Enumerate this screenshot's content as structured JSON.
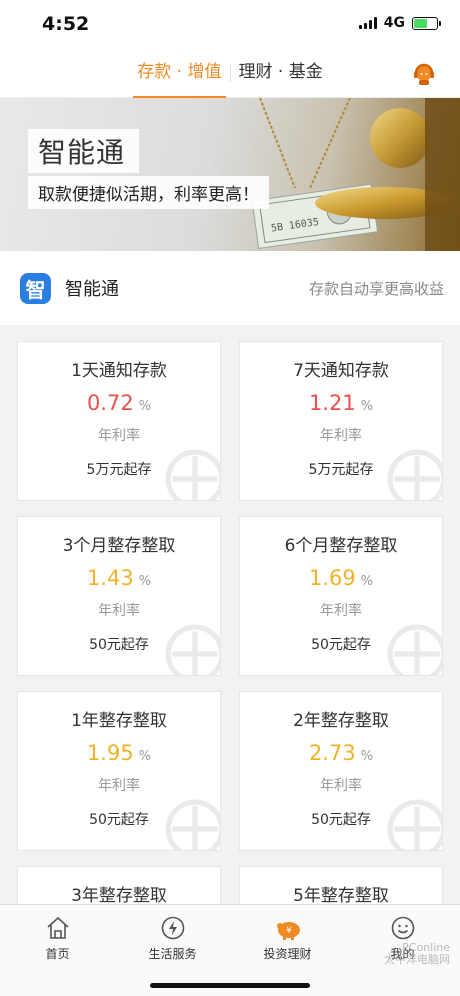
{
  "status": {
    "time": "4:52",
    "network": "4G",
    "battery_level": 0.6
  },
  "header": {
    "tabs": [
      {
        "label": "存款 · 增值",
        "active": true
      },
      {
        "label": "理财 · 基金",
        "active": false
      }
    ],
    "service_icon": "customer-service-icon"
  },
  "banner": {
    "title": "智能通",
    "subtitle": "取款便捷似活期，利率更高！"
  },
  "product": {
    "logo_char": "智",
    "name": "智能通",
    "description": "存款自动享更高收益"
  },
  "cards": [
    {
      "title": "1天通知存款",
      "rate": "0.72",
      "unit": "%",
      "rate_label": "年利率",
      "minimum": "5万元起存",
      "rate_color": "#e8524a"
    },
    {
      "title": "7天通知存款",
      "rate": "1.21",
      "unit": "%",
      "rate_label": "年利率",
      "minimum": "5万元起存",
      "rate_color": "#e8524a"
    },
    {
      "title": "3个月整存整取",
      "rate": "1.43",
      "unit": "%",
      "rate_label": "年利率",
      "minimum": "50元起存",
      "rate_color": "#f0b327"
    },
    {
      "title": "6个月整存整取",
      "rate": "1.69",
      "unit": "%",
      "rate_label": "年利率",
      "minimum": "50元起存",
      "rate_color": "#f0b327"
    },
    {
      "title": "1年整存整取",
      "rate": "1.95",
      "unit": "%",
      "rate_label": "年利率",
      "minimum": "50元起存",
      "rate_color": "#f0b327"
    },
    {
      "title": "2年整存整取",
      "rate": "2.73",
      "unit": "%",
      "rate_label": "年利率",
      "minimum": "50元起存",
      "rate_color": "#f0b327"
    },
    {
      "title": "3年整存整取"
    },
    {
      "title": "5年整存整取"
    }
  ],
  "bottom_nav": [
    {
      "label": "首页",
      "icon": "home-icon"
    },
    {
      "label": "生活服务",
      "icon": "lightning-icon"
    },
    {
      "label": "投资理财",
      "icon": "piggy-bank-icon",
      "active": true
    },
    {
      "label": "我的",
      "icon": "smiley-icon"
    }
  ],
  "watermark": {
    "line1": "PConline",
    "line2": "太平洋电脑网"
  },
  "colors": {
    "accent": "#f08a24",
    "rate_red": "#e8524a",
    "rate_yellow": "#f0b327",
    "logo_blue": "#2a7fe0"
  }
}
